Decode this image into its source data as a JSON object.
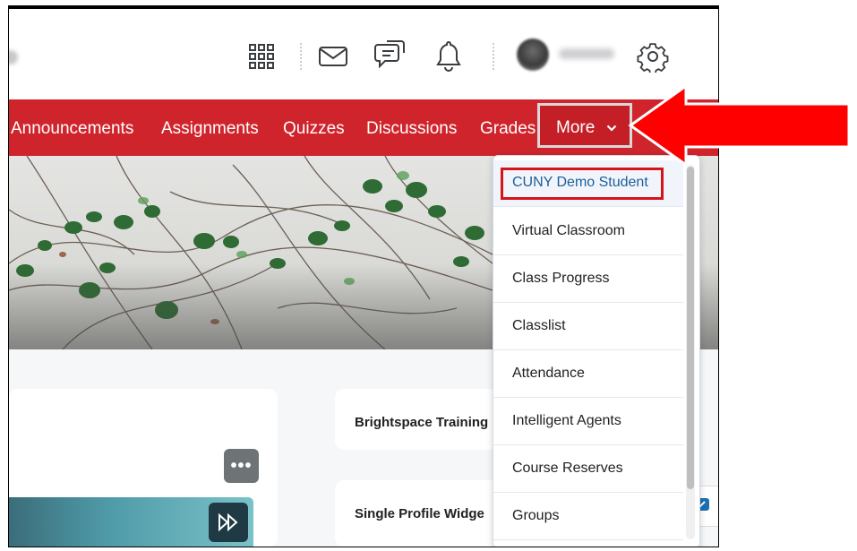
{
  "nav": {
    "items": [
      "Announcements",
      "Assignments",
      "Quizzes",
      "Discussions",
      "Grades"
    ],
    "more_label": "More"
  },
  "dropdown": {
    "items": [
      "CUNY Demo Student",
      "Virtual Classroom",
      "Class Progress",
      "Classlist",
      "Attendance",
      "Intelligent Agents",
      "Course Reserves",
      "Groups"
    ]
  },
  "widgets": {
    "brightspace_title": "Brightspace Training",
    "profile_title": "Single Profile Widge"
  },
  "widget_menu_glyph": "•••",
  "icons": [
    "apps-grid-icon",
    "mail-icon",
    "chat-bubble-icon",
    "bell-icon",
    "gear-icon",
    "chevron-down-icon",
    "ellipsis-icon",
    "fast-forward-icon",
    "chat-help-icon",
    "red-arrow-annotation"
  ],
  "colors": {
    "nav_red": "#d0242c",
    "highlight_red": "#d3141b",
    "arrow_red": "#ff0000",
    "link_blue": "#1b5e9b"
  }
}
